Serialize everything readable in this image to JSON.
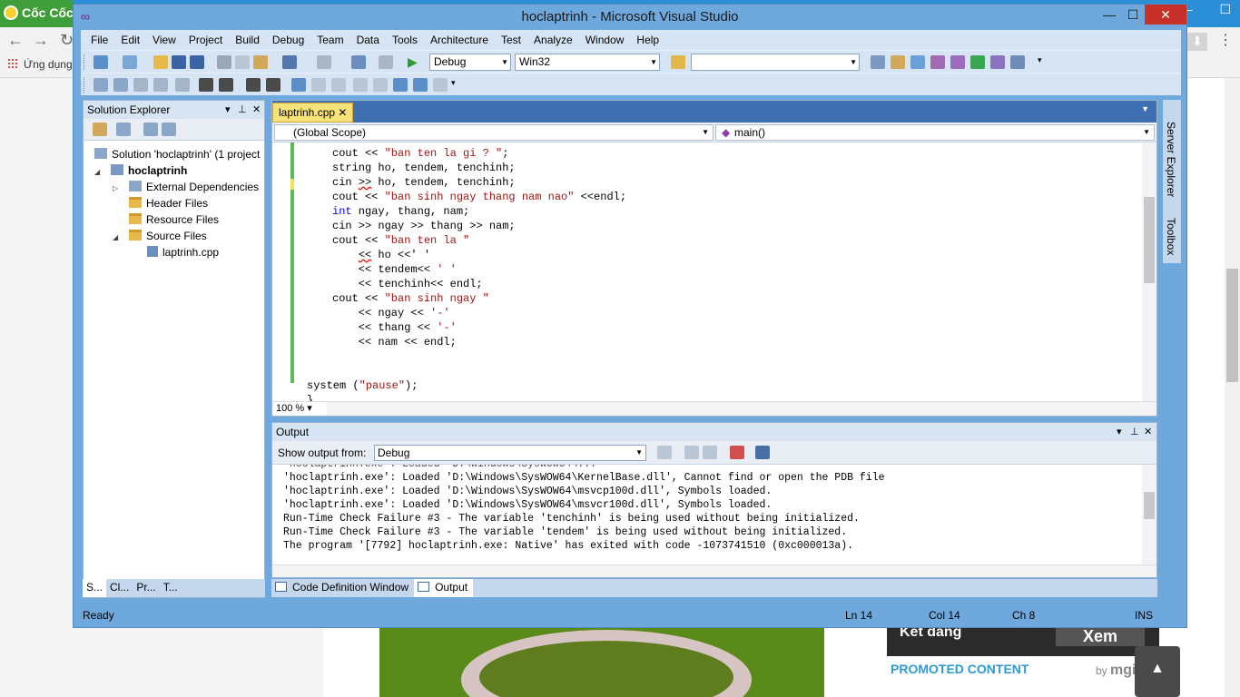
{
  "browser": {
    "tab_label": "Cốc Cốc",
    "bookmark_label": "Ứng dụng",
    "back_icon": "arrow-left-icon",
    "forward_icon": "arrow-right-icon",
    "ad_title": "Kết đắng",
    "ad_button": "Xem",
    "promoted": "PROMOTED CONTENT",
    "by": "by",
    "mgid": "mgid"
  },
  "vs": {
    "title": "hoclaptrinh - Microsoft Visual Studio",
    "menu": [
      "File",
      "Edit",
      "View",
      "Project",
      "Build",
      "Debug",
      "Team",
      "Data",
      "Tools",
      "Architecture",
      "Test",
      "Analyze",
      "Window",
      "Help"
    ],
    "toolbar": {
      "config": "Debug",
      "platform": "Win32",
      "find_value": ""
    },
    "solution_explorer": {
      "title": "Solution Explorer",
      "solution": "Solution 'hoclaptrinh' (1 project",
      "project": "hoclaptrinh",
      "items": [
        "External Dependencies",
        "Header Files",
        "Resource Files",
        "Source Files"
      ],
      "file": "laptrinh.cpp",
      "tabs": [
        "S...",
        "Cl...",
        "Pr...",
        "T..."
      ]
    },
    "editor": {
      "tab": "laptrinh.cpp",
      "scope": "(Global Scope)",
      "function": "main()",
      "zoom": "100 %",
      "lines": [
        [
          "",
          "cout << ",
          "\"ban ten la gi ? \"",
          ";"
        ],
        [
          "",
          "string ho, tendem, tenchinh;",
          "",
          ""
        ],
        [
          "",
          "cin ",
          ">>",
          " ho, tendem, tenchinh;"
        ],
        [
          "",
          "cout << ",
          "\"ban sinh ngay thang nam nao\"",
          " <<endl;"
        ],
        [
          "int",
          " ngay, thang, nam;",
          "",
          ""
        ],
        [
          "",
          "cin >> ngay >> thang >> nam;",
          "",
          ""
        ],
        [
          "",
          "cout << ",
          "\"ban ten la \"",
          ""
        ],
        [
          "",
          "    ",
          "<<",
          " ho <<' '"
        ],
        [
          "",
          "    << tendem<< ",
          "' '",
          ""
        ],
        [
          "",
          "    << tenchinh<< endl;",
          "",
          ""
        ],
        [
          "",
          "cout << ",
          "\"ban sinh ngay \"",
          ""
        ],
        [
          "",
          "    << ngay << ",
          "'-'",
          ""
        ],
        [
          "",
          "    << thang << ",
          "'-'",
          ""
        ],
        [
          "",
          "    << nam << endl;",
          "",
          ""
        ]
      ],
      "system_line_pre": "system (",
      "system_line_str": "\"pause\"",
      "system_line_post": ");",
      "last_line": "}"
    },
    "output": {
      "title": "Output",
      "show_from_label": "Show output from:",
      "source": "Debug",
      "lines": [
        "'hoclaptrinh.exe': Loaded 'D:\\Windows\\SysWOW64\\KernelBase.dll', Cannot find or open the PDB file",
        "'hoclaptrinh.exe': Loaded 'D:\\Windows\\SysWOW64\\msvcp100d.dll', Symbols loaded.",
        "'hoclaptrinh.exe': Loaded 'D:\\Windows\\SysWOW64\\msvcr100d.dll', Symbols loaded.",
        "Run-Time Check Failure #3 - The variable 'tenchinh' is being used without being initialized.",
        "Run-Time Check Failure #3 - The variable 'tendem' is being used without being initialized.",
        "The program '[7792] hoclaptrinh.exe: Native' has exited with code -1073741510 (0xc000013a)."
      ]
    },
    "bottom_tabs": [
      "Code Definition Window",
      "Output"
    ],
    "side_tabs": [
      "Server Explorer",
      "Toolbox"
    ],
    "status": {
      "ready": "Ready",
      "ln": "Ln 14",
      "col": "Col 14",
      "ch": "Ch 8",
      "mode": "INS"
    }
  }
}
